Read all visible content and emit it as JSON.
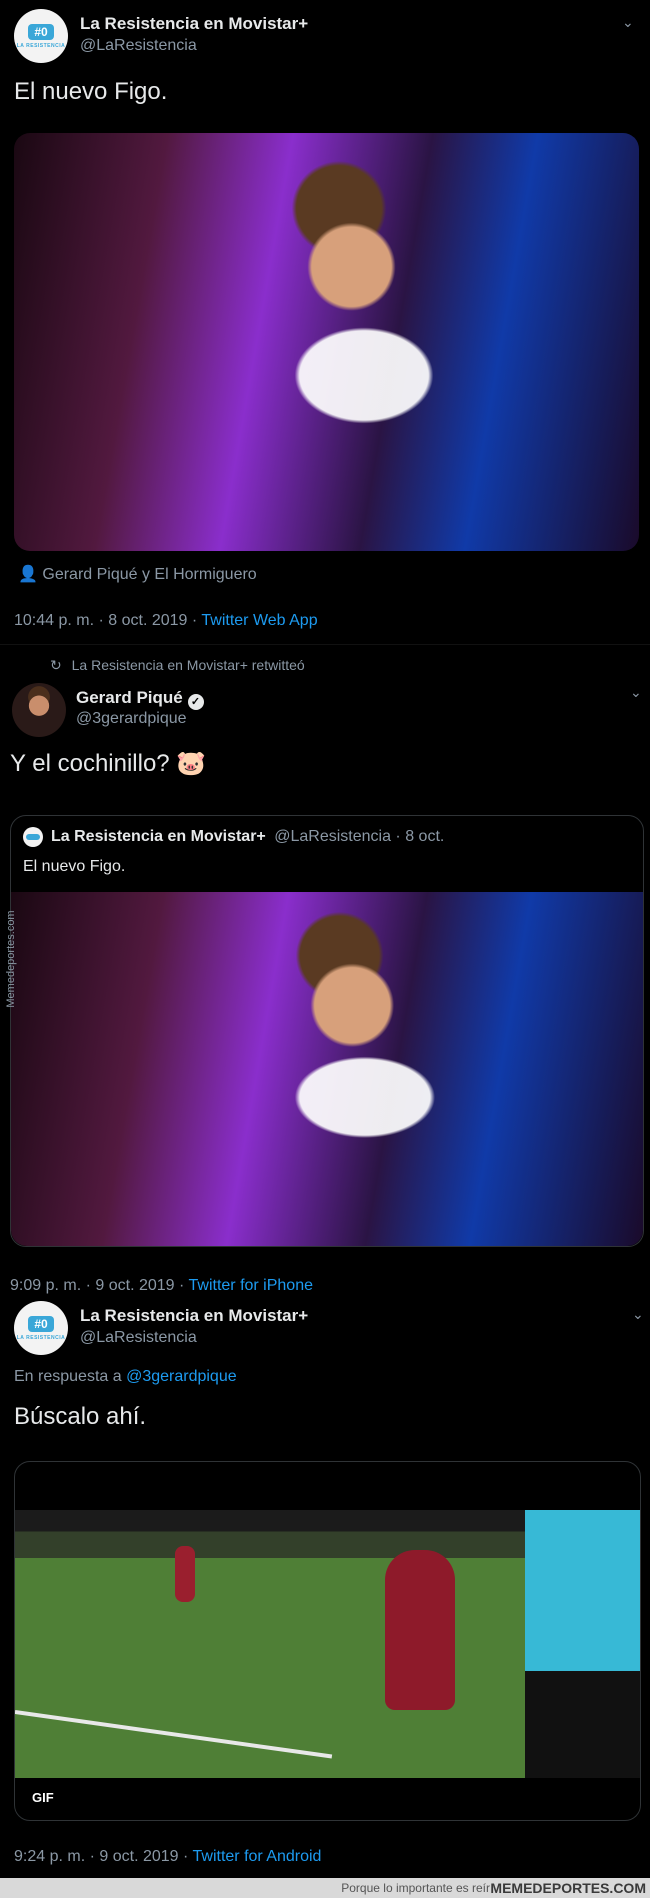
{
  "tweet1": {
    "author_name": "La Resistencia en Movistar+",
    "author_handle": "@LaResistencia",
    "avatar_badge": "#0",
    "avatar_text": "LA RESISTENCIA",
    "text": "El nuevo Figo.",
    "tagged": "Gerard Piqué y El Hormiguero",
    "time": "10:44 p. m.",
    "date": "8 oct. 2019",
    "source": "Twitter Web App"
  },
  "retweet_label": "La Resistencia en Movistar+ retwitteó",
  "tweet2": {
    "author_name": "Gerard Piqué",
    "author_handle": "@3gerardpique",
    "text": "Y el cochinillo?",
    "emoji": "🐷",
    "quote": {
      "author_name": "La Resistencia en Movistar+",
      "author_handle": "@LaResistencia",
      "date": "8 oct.",
      "text": "El nuevo Figo."
    },
    "time": "9:09 p. m.",
    "date": "9 oct. 2019",
    "source": "Twitter for iPhone"
  },
  "watermark_side": "Memedeportes.com",
  "tweet3": {
    "author_name": "La Resistencia en Movistar+",
    "author_handle": "@LaResistencia",
    "avatar_badge": "#0",
    "avatar_text": "LA RESISTENCIA",
    "reply_prefix": "En respuesta a",
    "reply_to": "@3gerardpique",
    "text": "Búscalo ahí.",
    "gif_label": "GIF",
    "time": "9:24 p. m.",
    "date": "9 oct. 2019",
    "source": "Twitter for Android"
  },
  "footer": {
    "tagline": "Porque lo importante es reír",
    "brand": "MEMEDEPORTES.COM"
  },
  "separator": "·",
  "colors": {
    "link": "#1d9bf0",
    "muted": "#8b98a5",
    "background": "#000000"
  }
}
